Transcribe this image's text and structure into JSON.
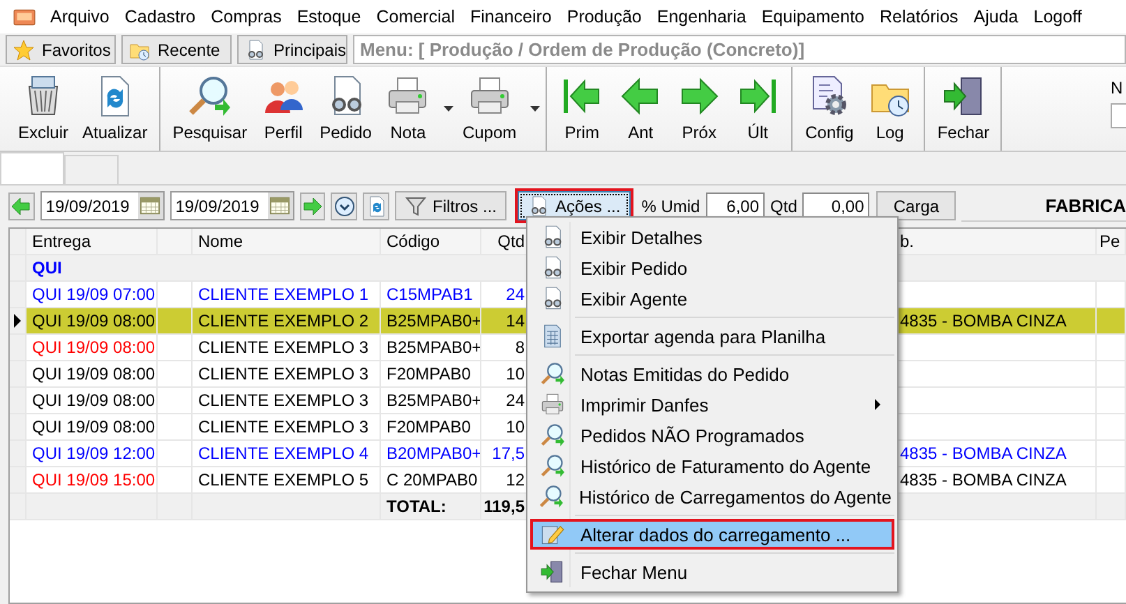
{
  "menu_bar": {
    "items": [
      "Arquivo",
      "Cadastro",
      "Compras",
      "Estoque",
      "Comercial",
      "Financeiro",
      "Produção",
      "Engenharia",
      "Equipamento",
      "Relatórios",
      "Ajuda",
      "Logoff"
    ]
  },
  "quick_tabs": [
    {
      "label": "Favoritos",
      "kind": "favorites"
    },
    {
      "label": "Recente",
      "kind": "recent"
    },
    {
      "label": "Principais",
      "kind": "main"
    }
  ],
  "menu_path": "Menu: [ Produção / Ordem de Produção (Concreto)]",
  "toolbar": {
    "groups": [
      {
        "buttons": [
          {
            "label": "Excluir",
            "kind": "delete",
            "has_dropdown": false
          },
          {
            "label": "Atualizar",
            "kind": "refresh",
            "has_dropdown": false
          }
        ]
      },
      {
        "buttons": [
          {
            "label": "Pesquisar",
            "kind": "search",
            "has_dropdown": false
          },
          {
            "label": "Perfil",
            "kind": "profile",
            "has_dropdown": false
          },
          {
            "label": "Pedido",
            "kind": "order",
            "has_dropdown": false
          },
          {
            "label": "Nota",
            "kind": "print",
            "has_dropdown": true
          },
          {
            "label": "Cupom",
            "kind": "print",
            "has_dropdown": true
          }
        ]
      },
      {
        "buttons": [
          {
            "label": "Prim",
            "kind": "first",
            "has_dropdown": false
          },
          {
            "label": "Ant",
            "kind": "prev",
            "has_dropdown": false
          },
          {
            "label": "Próx",
            "kind": "next",
            "has_dropdown": false
          },
          {
            "label": "Últ",
            "kind": "last",
            "has_dropdown": false
          }
        ]
      },
      {
        "buttons": [
          {
            "label": "Config",
            "kind": "config",
            "has_dropdown": false
          },
          {
            "label": "Log",
            "kind": "log",
            "has_dropdown": false
          }
        ]
      },
      {
        "buttons": [
          {
            "label": "Fechar",
            "kind": "exit",
            "has_dropdown": false
          }
        ]
      }
    ],
    "cut_label": "N"
  },
  "page_tabs": [
    {
      "selected": true
    },
    {
      "selected": false
    }
  ],
  "filter_bar": {
    "start_date": "19/09/2019",
    "end_date": "19/09/2019",
    "filters_button": "Filtros ...",
    "actions_button": {
      "label": "Ações ...",
      "open": true,
      "marked": true
    },
    "humidity": {
      "label": "% Umid",
      "value": "6,00"
    },
    "quantity": {
      "label": "Qtd",
      "value": "0,00"
    },
    "load_button": "Carga",
    "factory": "FABRICA"
  },
  "grid": {
    "headers": {
      "date": "Entrega",
      "name": "Nome",
      "code": "Código",
      "qty": "Qtd",
      "column_7": "b.",
      "column_8": "Pe"
    },
    "group": "QUI",
    "rows": [
      {
        "date": {
          "text": "QUI 19/09 07:00",
          "color": "#0000ff"
        },
        "name": "CLIENTE EXEMPLO 1",
        "code": "C15MPAB1",
        "qty": "24",
        "color": "#0000ff",
        "selected": false
      },
      {
        "date": {
          "text": "QUI 19/09 08:00",
          "color": "#000000"
        },
        "name": "CLIENTE EXEMPLO 2",
        "code": "B25MPAB0+",
        "qty": "14",
        "column_7": "4835 - BOMBA CINZA",
        "color": "#000000",
        "selected": true
      },
      {
        "date": {
          "text": "QUI 19/09 08:00",
          "color": "#ff0000"
        },
        "name": "CLIENTE EXEMPLO 3",
        "code": "B25MPAB0+",
        "qty": "8",
        "color": "#000000",
        "selected": false
      },
      {
        "date": {
          "text": "QUI 19/09 08:00",
          "color": "#000000"
        },
        "name": "CLIENTE EXEMPLO 3",
        "code": "F20MPAB0",
        "qty": "10",
        "color": "#000000",
        "selected": false
      },
      {
        "date": {
          "text": "QUI 19/09 08:00",
          "color": "#000000"
        },
        "name": "CLIENTE EXEMPLO 3",
        "code": "B25MPAB0+",
        "qty": "24",
        "color": "#000000",
        "selected": false
      },
      {
        "date": {
          "text": "QUI 19/09 08:00",
          "color": "#000000"
        },
        "name": "CLIENTE EXEMPLO 3",
        "code": "F20MPAB0",
        "qty": "10",
        "color": "#000000",
        "selected": false
      },
      {
        "date": {
          "text": "QUI 19/09 12:00",
          "color": "#0000ff"
        },
        "name": "CLIENTE EXEMPLO 4",
        "code": "B20MPAB0+",
        "qty": "17,5",
        "column_7": "4835 - BOMBA CINZA",
        "color": "#0000ff",
        "selected": false
      },
      {
        "date": {
          "text": "QUI 19/09 15:00",
          "color": "#ff0000"
        },
        "name": "CLIENTE EXEMPLO 5",
        "code": "C 20MPAB0",
        "qty": "12",
        "column_7": "4835 - BOMBA CINZA",
        "color": "#000000",
        "selected": false
      }
    ],
    "total": {
      "label": "TOTAL:",
      "qty": "119,5"
    }
  },
  "context_menu": {
    "sections": [
      {
        "items": [
          {
            "label": "Exibir Detalhes",
            "kind": "view",
            "selected": false,
            "marked": false,
            "has_submenu": false
          },
          {
            "label": "Exibir Pedido",
            "kind": "view",
            "selected": false,
            "marked": false,
            "has_submenu": false
          },
          {
            "label": "Exibir Agente",
            "kind": "view",
            "selected": false,
            "marked": false,
            "has_submenu": false
          }
        ]
      },
      {
        "items": [
          {
            "label": "Exportar agenda para Planilha",
            "kind": "export",
            "selected": false,
            "marked": false,
            "has_submenu": false
          }
        ]
      },
      {
        "items": [
          {
            "label": "Notas Emitidas do Pedido",
            "kind": "search",
            "selected": false,
            "marked": false,
            "has_submenu": false
          },
          {
            "label": "Imprimir Danfes",
            "kind": "print",
            "selected": false,
            "marked": false,
            "has_submenu": true
          },
          {
            "label": "Pedidos NÃO Programados",
            "kind": "search",
            "selected": false,
            "marked": false,
            "has_submenu": false
          },
          {
            "label": "Histórico de Faturamento do Agente",
            "kind": "search",
            "selected": false,
            "marked": false,
            "has_submenu": false
          },
          {
            "label": "Histórico de Carregamentos do Agente",
            "kind": "search",
            "selected": false,
            "marked": false,
            "has_submenu": false
          }
        ]
      },
      {
        "items": [
          {
            "label": "Alterar dados do carregamento ...",
            "kind": "edit",
            "selected": true,
            "marked": true,
            "has_submenu": false
          }
        ]
      },
      {
        "items": [
          {
            "label": "Fechar Menu",
            "kind": "exit",
            "selected": false,
            "marked": false,
            "has_submenu": false
          }
        ]
      }
    ]
  }
}
